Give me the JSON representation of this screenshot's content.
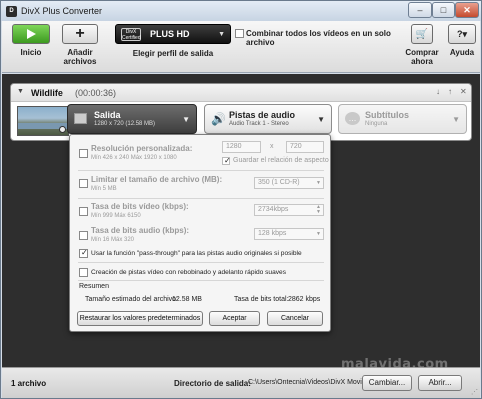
{
  "window": {
    "title": "DivX Plus Converter",
    "controls": {
      "minimize": "–",
      "maximize": "□",
      "close": "✕"
    }
  },
  "toolbar": {
    "start_label": "Inicio",
    "add_label": "Añadir archivos",
    "add_glyph": "+",
    "start_glyph": "▶",
    "profile": {
      "logo_text": "DivX Certified",
      "name": "PLUS HD",
      "caption": "Elegir perfil de salida"
    },
    "combine_label": "Combinar todos los vídeos en un solo archivo",
    "buy_label": "Comprar ahora",
    "buy_glyph": "🛒",
    "help_label": "Ayuda",
    "help_glyph": "?▾"
  },
  "task": {
    "toggle": "▼",
    "name": "Wildlife",
    "duration": "(00:00:36)",
    "controls": [
      "↓",
      "↑",
      "✕"
    ],
    "output": {
      "title": "Salida",
      "subtitle": "1280 x 720 (12.58 MB)",
      "caret": "▼"
    },
    "audio": {
      "title": "Pistas de audio",
      "subtitle": "Audio Track 1 - Stereo",
      "caret": "▼",
      "icon": "🔊"
    },
    "subtitles": {
      "title": "Subtítulos",
      "subtitle": "Ninguna",
      "caret": "▼"
    }
  },
  "popup": {
    "resolution": {
      "title": "Resolución personalizada:",
      "hint": "Mín 426 x 240   Máx 1920 x 1080",
      "width": "1280",
      "height": "720",
      "separator": "x",
      "keep_aspect": "Guardar el relación de aspecto"
    },
    "filesize": {
      "title": "Limitar el tamaño de archivo (MB):",
      "hint": "Mín 5 MB",
      "value": "350 (1 CD-R)"
    },
    "video_bitrate": {
      "title": "Tasa de bits vídeo (kbps):",
      "hint": "Mín 999   Máx 6150",
      "value": "2734kbps"
    },
    "audio_bitrate": {
      "title": "Tasa de bits audio (kbps):",
      "hint": "Mín 16   Máx 320",
      "value": "128 kbps"
    },
    "passthrough": "Usar la función \"pass-through\" para las pistas audio originales si posible",
    "rewind": "Creación de pistas vídeo con rebobinado y adelanto rápido suaves",
    "summary_label": "Resumen",
    "estimated_size_label": "Tamaño estimado del archivo:",
    "estimated_size_value": "12.58 MB",
    "total_bitrate_label": "Tasa de bits total:",
    "total_bitrate_value": "2862 kbps",
    "buttons": {
      "reset": "Restaurar los valores predeterminados",
      "accept": "Aceptar",
      "cancel": "Cancelar"
    }
  },
  "status": {
    "file_count": "1 archivo",
    "dir_label": "Directorio de salida:",
    "dir_path": "C:\\Users\\Ontecnia\\Videos\\DivX Movies",
    "change_label": "Cambiar...",
    "open_label": "Abrir..."
  },
  "watermark": "malavida.com"
}
